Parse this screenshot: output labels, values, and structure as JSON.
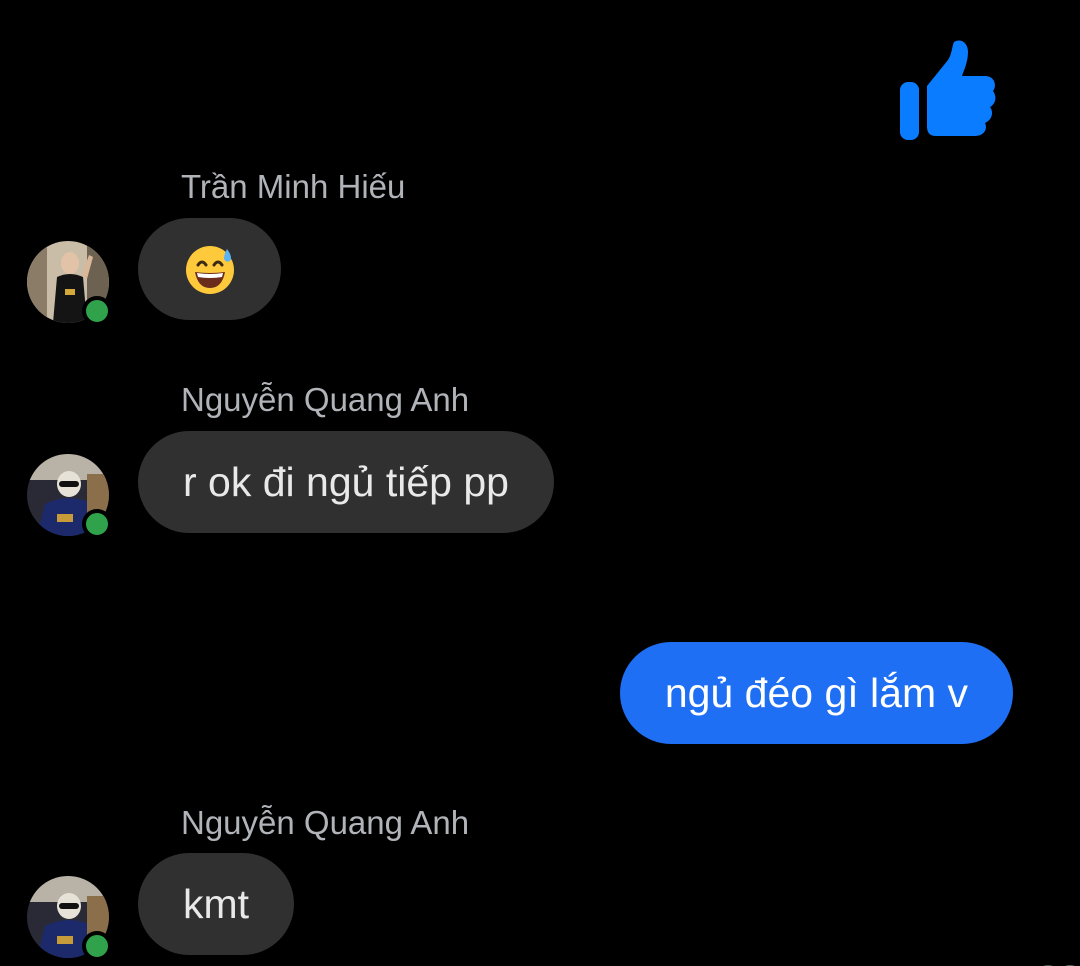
{
  "colors": {
    "background": "#000000",
    "incoming_bubble": "#303030",
    "outgoing_bubble": "#1f6ff4",
    "like_icon": "#0a7cff",
    "online_dot": "#31a24c",
    "sender_name": "#b0b3b8"
  },
  "like_reaction": {
    "icon": "thumbs-up-icon"
  },
  "messages": [
    {
      "direction": "incoming",
      "sender": "Trần Minh Hiếu",
      "content_type": "emoji",
      "emoji": "😅",
      "avatar": "avatar-tran-minh-hieu",
      "online": true
    },
    {
      "direction": "incoming",
      "sender": "Nguyễn Quang Anh",
      "content_type": "text",
      "text": "r ok đi ngủ tiếp pp",
      "avatar": "avatar-nguyen-quang-anh",
      "online": true
    },
    {
      "direction": "outgoing",
      "content_type": "text",
      "text": "ngủ đéo gì lắm v"
    },
    {
      "direction": "incoming",
      "sender": "Nguyễn Quang Anh",
      "content_type": "text",
      "text": "kmt",
      "avatar": "avatar-nguyen-quang-anh",
      "online": true
    }
  ]
}
